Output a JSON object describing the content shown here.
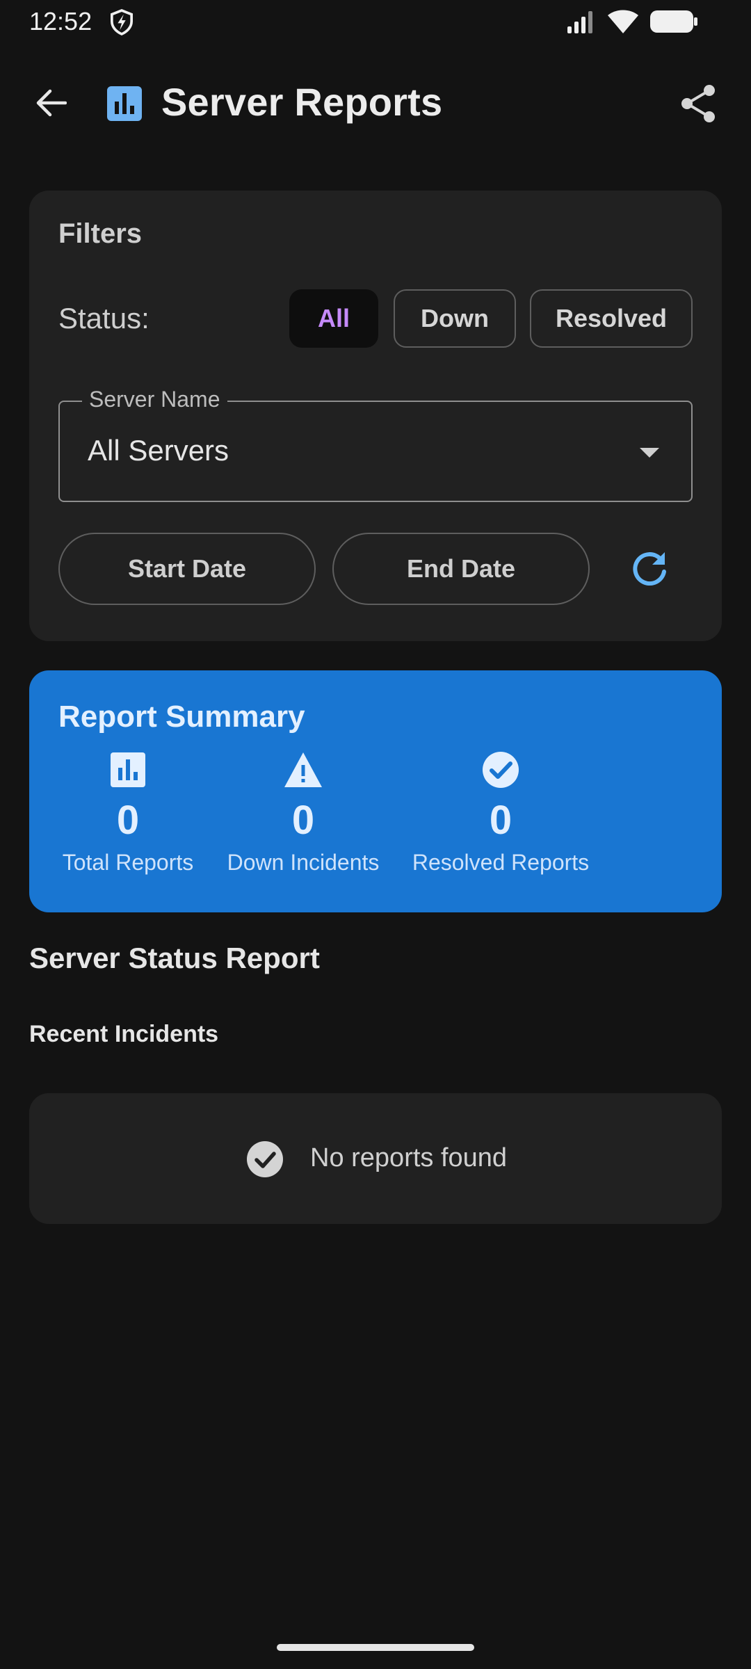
{
  "status_bar": {
    "time": "12:52",
    "icons": [
      "shield-icon",
      "signal-icon",
      "wifi-icon",
      "battery-icon"
    ]
  },
  "app_bar": {
    "title": "Server Reports",
    "icons": [
      "back-arrow-icon",
      "bar-chart-icon",
      "share-icon"
    ]
  },
  "filters": {
    "title": "Filters",
    "status_label": "Status:",
    "status_chips": [
      {
        "label": "All",
        "selected": true
      },
      {
        "label": "Down",
        "selected": false
      },
      {
        "label": "Resolved",
        "selected": false
      }
    ],
    "server_select": {
      "label": "Server Name",
      "value": "All Servers"
    },
    "start_date_label": "Start Date",
    "end_date_label": "End Date"
  },
  "summary": {
    "title": "Report Summary",
    "stats": [
      {
        "label": "Total Reports",
        "value": "0",
        "icon": "bar-chart-icon"
      },
      {
        "label": "Down Incidents",
        "value": "0",
        "icon": "warning-icon"
      },
      {
        "label": "Resolved Reports",
        "value": "0",
        "icon": "check-circle-icon"
      }
    ]
  },
  "report": {
    "section_title": "Server Status Report",
    "subsection_title": "Recent Incidents",
    "empty_text": "No reports found"
  },
  "colors": {
    "background": "#131313",
    "card": "#212121",
    "summary_blue": "#1976d2",
    "selected_chip_text": "#c58af9",
    "accent_icon": "#64b5f6"
  }
}
